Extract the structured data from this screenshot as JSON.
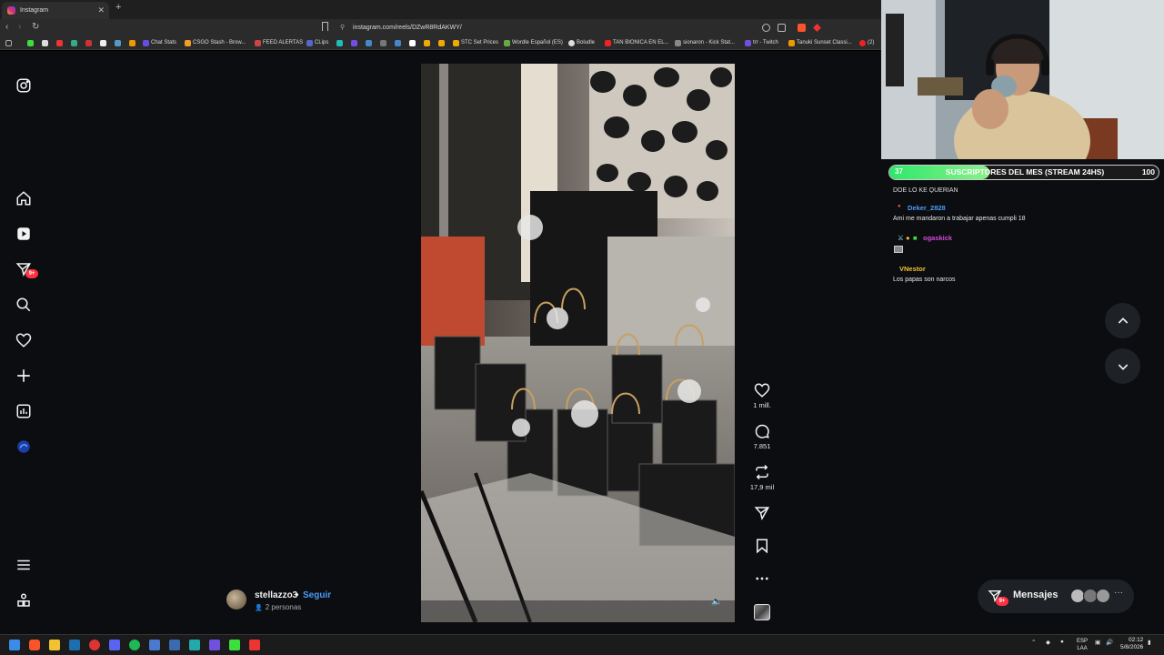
{
  "browser": {
    "tab_title": "Instagram",
    "url": "instagram.com/reels/DZwR8RdAKWY/",
    "bookmarks": [
      "Chat Stats",
      "CSGO Stash - Brow...",
      "FEED ALERTAS",
      "CLips",
      "STC Set Prices",
      "Wordle Español (ES)",
      "Boludle",
      "TAN BIONICA EN EL...",
      "sionaron - Kick Stat...",
      "trr - Twitch",
      "Tanuki Sunset Classi...",
      "(2)"
    ]
  },
  "instagram": {
    "sidebar": {
      "notification_badge": "9+"
    },
    "reel": {
      "likes": "1 mill.",
      "comments": "7.851",
      "reposts": "17,9 mil",
      "author": {
        "username": "stellazzo3",
        "separator": "•",
        "follow_label": "Seguir",
        "people": "2 personas"
      }
    },
    "messages": {
      "label": "Mensajes",
      "badge": "9+",
      "more": "···"
    }
  },
  "stream": {
    "sub_goal": {
      "current": "37",
      "title": "SUSCRIPTORES DEL MES (STREAM 24HS)",
      "target": "100",
      "progress_fraction": 0.37
    },
    "chat": [
      {
        "user": "",
        "text": "DOE LO KE QUERIAN"
      },
      {
        "user": "Deker_2828",
        "text": "Ami me mandaron a trabajar apenas cumpli 18",
        "color": "#4a9cf8"
      },
      {
        "user": "ogaskick",
        "text": "",
        "color": "#d04ad8"
      },
      {
        "user": "VNestor",
        "text": "Los papas son narcos",
        "color": "#f2c230"
      }
    ]
  },
  "taskbar": {
    "language": "ESP",
    "language_sub": "LAA",
    "time": "02:12",
    "date": "5/8/2026"
  },
  "colors": {
    "page_bg": "#0b0d10",
    "accent_blue": "#4a9cf8",
    "badge_red": "#ff3040",
    "goal_green": "#2ee86a"
  }
}
